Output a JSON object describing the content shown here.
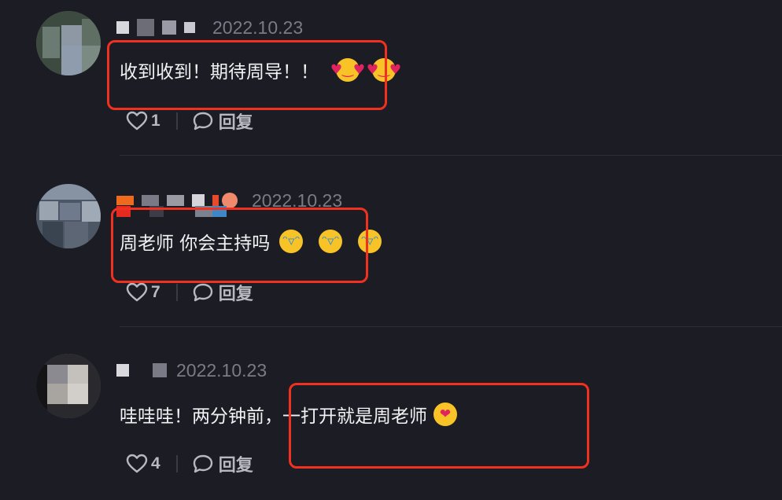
{
  "comments": [
    {
      "date": "2022.10.23",
      "text": "收到收到！期待周导！！",
      "emojis": [
        "heart-eyes-emoji",
        "heart-eyes-emoji"
      ],
      "likes": "1",
      "reply_label": "回复"
    },
    {
      "date": "2022.10.23",
      "text": "周老师 你会主持吗",
      "emojis": [
        "crying-laughing-emoji",
        "crying-laughing-emoji",
        "crying-laughing-emoji"
      ],
      "likes": "7",
      "reply_label": "回复"
    },
    {
      "date": "2022.10.23",
      "text": "哇哇哇！两分钟前，一打开就是周老师",
      "emojis": [
        "hugging-face-emoji"
      ],
      "likes": "4",
      "reply_label": "回复"
    }
  ],
  "colors": {
    "background": "#1c1c24",
    "highlight_box": "#f2301f",
    "secondary_text": "#7b7b87"
  }
}
